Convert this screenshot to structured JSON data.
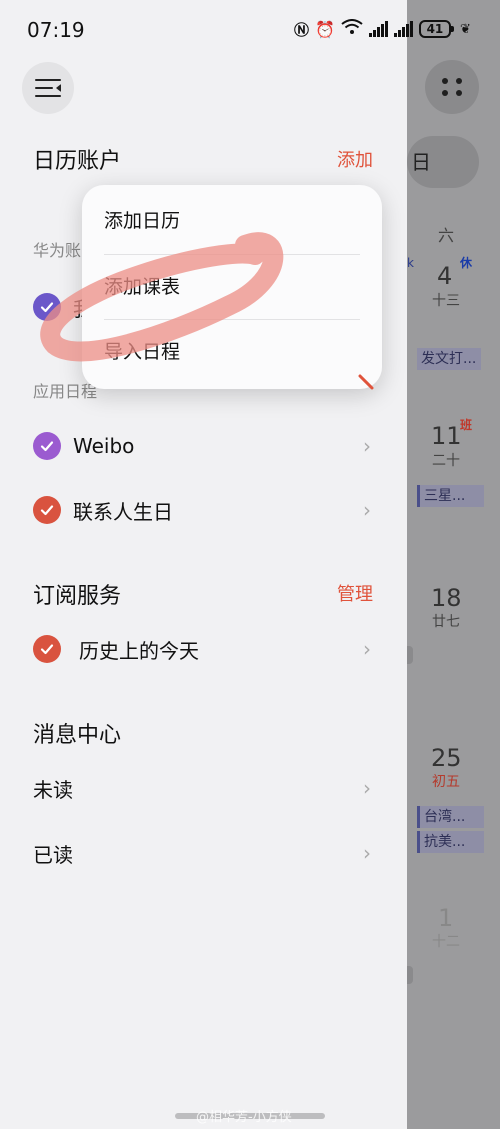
{
  "status": {
    "time": "07:19",
    "battery": "41"
  },
  "background_calendar": {
    "pill_text": "日",
    "weekday": "六",
    "badge_rest": "休",
    "badge_work": "班",
    "days": [
      {
        "num": "4",
        "lunar": "十三"
      },
      {
        "num": "11",
        "lunar": "二十"
      },
      {
        "num": "18",
        "lunar": "廿七"
      },
      {
        "num": "25",
        "lunar": "初五"
      },
      {
        "num": "1",
        "lunar": "十二"
      }
    ],
    "events": [
      "发文打...",
      "三星...",
      "台湾...",
      "抗美..."
    ]
  },
  "drawer": {
    "accounts": {
      "title": "日历账户",
      "action": "添加",
      "sub_label": "华为账",
      "item_partial": "我"
    },
    "app_calendars": {
      "title": "应用日程",
      "items": [
        {
          "label": "Weibo",
          "color": "#9b5bd0"
        },
        {
          "label": "联系人生日",
          "color": "#d9533f"
        }
      ]
    },
    "subscriptions": {
      "title": "订阅服务",
      "action": "管理",
      "items": [
        {
          "label": "历史上的今天",
          "color": "#d9533f"
        }
      ]
    },
    "messages": {
      "title": "消息中心",
      "items": [
        {
          "label": "未读"
        },
        {
          "label": "已读"
        }
      ]
    }
  },
  "popup": {
    "items": [
      "添加日历",
      "添加课表",
      "导入日程"
    ]
  },
  "watermark": "@相华芳-小方侠",
  "colors": {
    "accent": "#e0533b",
    "purple": "#6b57c9"
  }
}
